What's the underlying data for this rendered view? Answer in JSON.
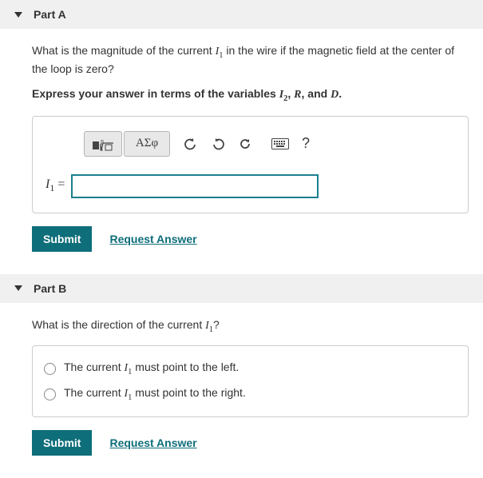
{
  "partA": {
    "title": "Part A",
    "question_pre": "What is the magnitude of the current ",
    "question_var": "I",
    "question_sub": "1",
    "question_post": " in the wire if the magnetic field at the center of the loop is zero?",
    "instruction_pre": "Express your answer in terms of the variables ",
    "instruction_v1": "I",
    "instruction_s1": "2",
    "instruction_mid1": ", ",
    "instruction_v2": "R",
    "instruction_mid2": ", and ",
    "instruction_v3": "D",
    "instruction_post": ".",
    "toolbar": {
      "greek": "ΑΣφ",
      "help": "?"
    },
    "answer_label_var": "I",
    "answer_label_sub": "1",
    "answer_label_eq": " = ",
    "answer_value": "",
    "submit": "Submit",
    "request": "Request Answer"
  },
  "partB": {
    "title": "Part B",
    "question_pre": "What is the direction of the current ",
    "question_var": "I",
    "question_sub": "1",
    "question_post": "?",
    "option1_pre": "The current ",
    "option1_var": "I",
    "option1_sub": "1",
    "option1_post": " must point to the left.",
    "option2_pre": "The current ",
    "option2_var": "I",
    "option2_sub": "1",
    "option2_post": " must point to the right.",
    "submit": "Submit",
    "request": "Request Answer"
  }
}
